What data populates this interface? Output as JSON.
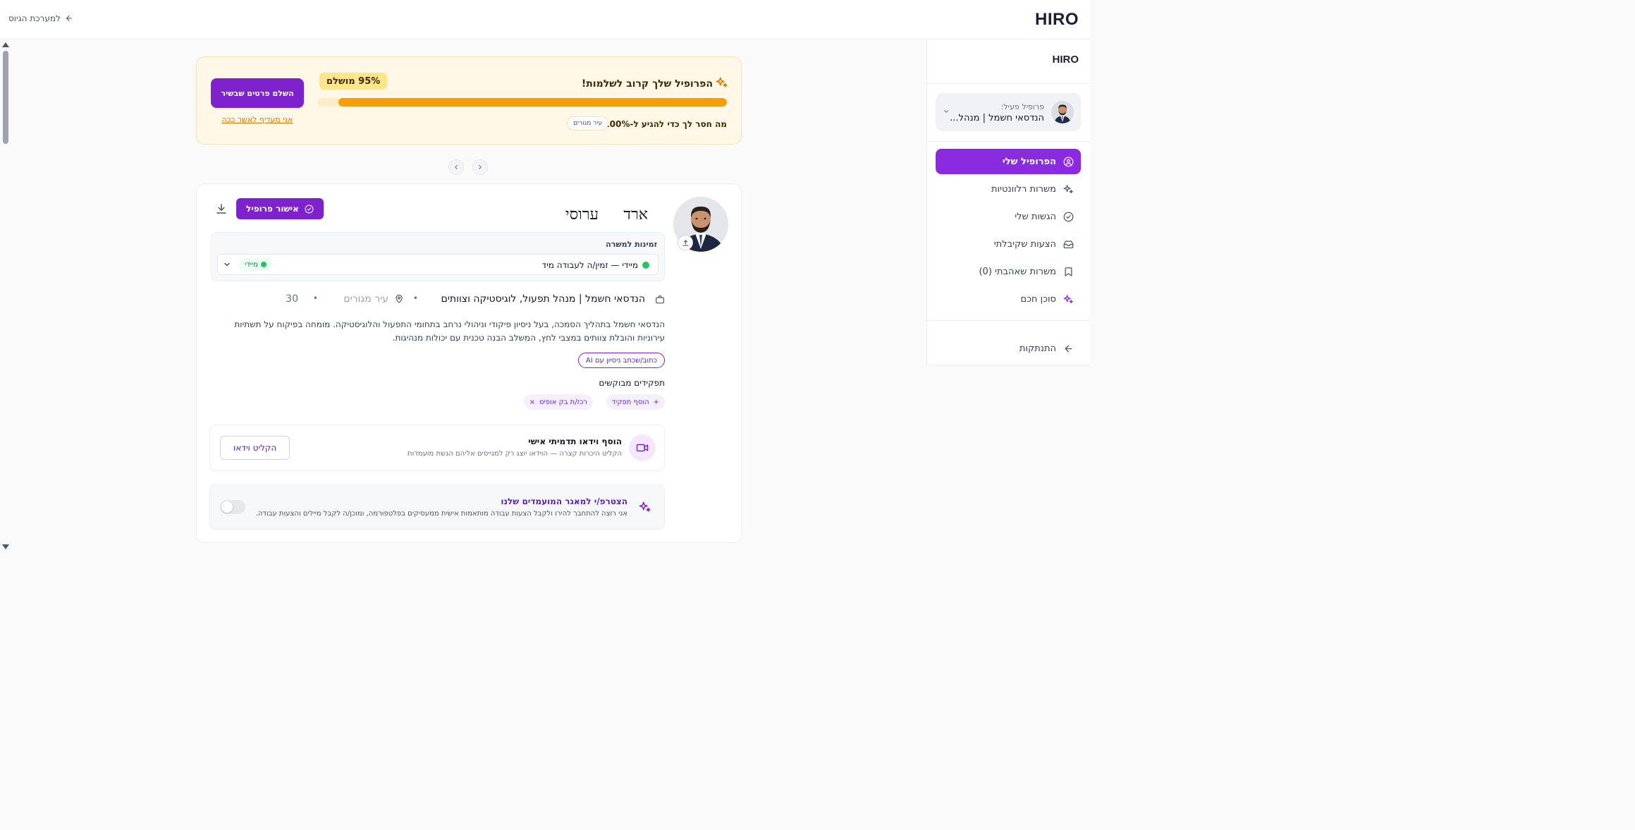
{
  "app": {
    "logo": "HIRO",
    "back_link": "למערכת הגיוס"
  },
  "sidebar": {
    "logo": "HIRO",
    "profile": {
      "label": "פרופיל פעיל:",
      "name": "הנדסאי חשמל | מנהל..."
    },
    "items": [
      {
        "label": "הפרופיל שלי",
        "icon": "user-circle-icon",
        "active": true
      },
      {
        "label": "משרות רלוונטיות",
        "icon": "sparkles-icon",
        "active": false
      },
      {
        "label": "הגשות שלי",
        "icon": "check-circle-icon",
        "active": false
      },
      {
        "label": "הצעות שקיבלתי",
        "icon": "inbox-icon",
        "active": false
      },
      {
        "label": "משרות שאהבתי (0)",
        "icon": "bookmark-icon",
        "active": false
      },
      {
        "label": "סוכן חכם",
        "icon": "sparkles-icon",
        "active": false
      }
    ],
    "logout": "התנתקות"
  },
  "banner": {
    "title": "הפרופיל שלך קרוב לשלמות!",
    "percent_label": "95% מושלם",
    "progress": 0.95,
    "question": "מה חסר לך כדי להגיע ל-100%?",
    "missing_chip": "עיר מגורים",
    "complete_button": "השלם פרטים שבשיר",
    "later_link": "אני מעדיף לאשר ככה"
  },
  "profile": {
    "first_name": "ארד",
    "last_name": "ערוסי",
    "approve_button": "אישור פרופיל",
    "availability": {
      "label": "זמינות למשרה",
      "value": "מיידי — זמין/ה לעבודה מיד",
      "chip": "מיידי"
    },
    "job_title": "הנדסאי חשמל | מנהל תפעול, לוגיסטיקה וצוותים",
    "city_placeholder": "עיר מגורים",
    "age": "30",
    "bio": "הנדסאי חשמל בתהליך הסמכה, בעל ניסיון פיקודי וניהולי נרחב בתחומי התפעול והלוגיסטיקה. מומחה בפיקוח על תשתיות עירוניות והובלת צוותים במצבי לחץ, המשלב הבנה טכנית עם יכולות מנהיגות.",
    "ai_button": "כתוב/שכתב ניסיון עם AI",
    "roles_title": "תפקידים מבוקשים",
    "add_role": "הוסף תפקיד",
    "roles": [
      "רכז/ת בק אופיס"
    ],
    "video": {
      "title": "הוסף וידאו תדמיתי אישי",
      "subtitle": "הקליט היכרות קצרה — הוידאו יוצג רק למגייסים אליהם הגשת מועמדות",
      "button": "הקליט וידאו"
    },
    "pool": {
      "title": "הצטרפ/י למאגר המועמדים שלנו",
      "subtitle": "אני רוצה להתחבר להירו ולקבל הצעות עבודה מותאמות אישית ממעסיקים בפלטפורמה, ומוכן/ה לקבל מיילים והצעות עבודה.",
      "enabled": false
    }
  },
  "colors": {
    "accent": "#7e22ce",
    "progress": "#f59e0b",
    "banner_bg": "#fff8e6"
  }
}
